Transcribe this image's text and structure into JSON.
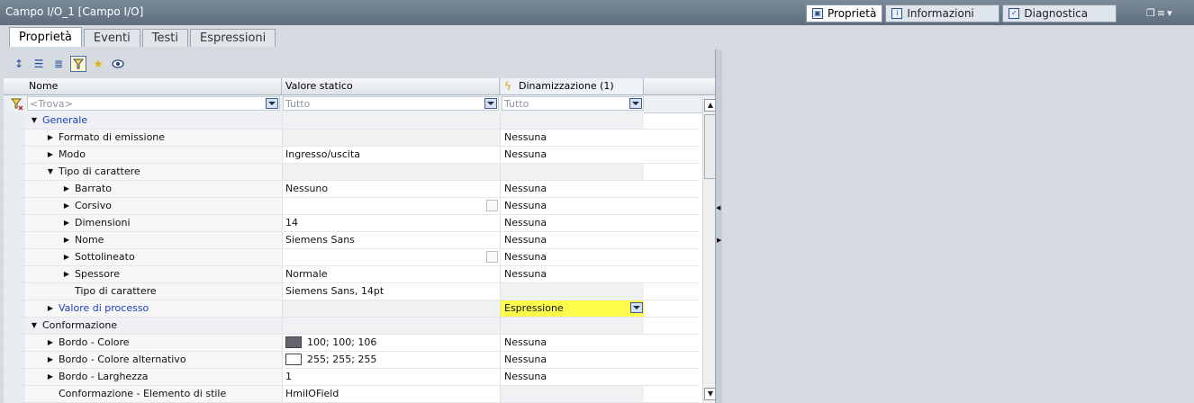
{
  "window": {
    "title": "Campo I/O_1 [Campo I/O]"
  },
  "right_tabs": [
    {
      "label": "Proprietà",
      "icon": "properties-icon"
    },
    {
      "label": "Informazioni",
      "icon": "info-icon"
    },
    {
      "label": "Diagnostica",
      "icon": "diagnostics-icon"
    }
  ],
  "prop_tabs": [
    "Proprietà",
    "Eventi",
    "Testi",
    "Espressioni"
  ],
  "columns": {
    "name": "Nome",
    "static": "Valore statico",
    "dynamic": "Dinamizzazione (1)"
  },
  "filter": {
    "name_placeholder": "<Trova>",
    "static_value": "Tutto",
    "dynamic_value": "Tutto"
  },
  "rows": [
    {
      "indent": 0,
      "expander": "down",
      "name": "Generale",
      "blue": true,
      "group": true,
      "static": "",
      "dynamic": ""
    },
    {
      "indent": 1,
      "expander": "right",
      "name": "Formato di emissione",
      "static": "",
      "dynamic": "Nessuna"
    },
    {
      "indent": 1,
      "expander": "right",
      "name": "Modo",
      "static": "Ingresso/uscita",
      "dynamic": "Nessuna"
    },
    {
      "indent": 1,
      "expander": "down",
      "name": "Tipo di carattere",
      "static": "",
      "dynamic": ""
    },
    {
      "indent": 2,
      "expander": "right",
      "name": "Barrato",
      "static": "Nessuno",
      "dynamic": "Nessuna"
    },
    {
      "indent": 2,
      "expander": "right",
      "name": "Corsivo",
      "static": "",
      "checkbox": true,
      "dynamic": "Nessuna"
    },
    {
      "indent": 2,
      "expander": "right",
      "name": "Dimensioni",
      "static": "14",
      "dynamic": "Nessuna"
    },
    {
      "indent": 2,
      "expander": "right",
      "name": "Nome",
      "static": "Siemens Sans",
      "dynamic": "Nessuna"
    },
    {
      "indent": 2,
      "expander": "right",
      "name": "Sottolineato",
      "static": "",
      "checkbox": true,
      "dynamic": "Nessuna"
    },
    {
      "indent": 2,
      "expander": "right",
      "name": "Spessore",
      "static": "Normale",
      "dynamic": "Nessuna"
    },
    {
      "indent": 2,
      "expander": "none",
      "name": "Tipo di carattere",
      "static": "Siemens Sans, 14pt",
      "dynamic": ""
    },
    {
      "indent": 1,
      "expander": "right",
      "name": "Valore di processo",
      "blue": true,
      "static": "",
      "dynamic": "Espressione",
      "dropdown": true,
      "highlight": true
    },
    {
      "indent": 0,
      "expander": "down",
      "name": "Conformazione",
      "group": true,
      "static": "",
      "dynamic": ""
    },
    {
      "indent": 1,
      "expander": "right",
      "name": "Bordo - Colore",
      "static": "100; 100; 106",
      "swatch": "#646470",
      "dynamic": "Nessuna"
    },
    {
      "indent": 1,
      "expander": "right",
      "name": "Bordo - Colore alternativo",
      "static": "255; 255; 255",
      "swatch": "#ffffff",
      "dynamic": "Nessuna"
    },
    {
      "indent": 1,
      "expander": "right",
      "name": "Bordo - Larghezza",
      "static": "1",
      "dynamic": "Nessuna"
    },
    {
      "indent": 1,
      "expander": "none",
      "name": "Conformazione - Elemento di stile",
      "static": "HmiIOField",
      "dynamic": ""
    }
  ]
}
